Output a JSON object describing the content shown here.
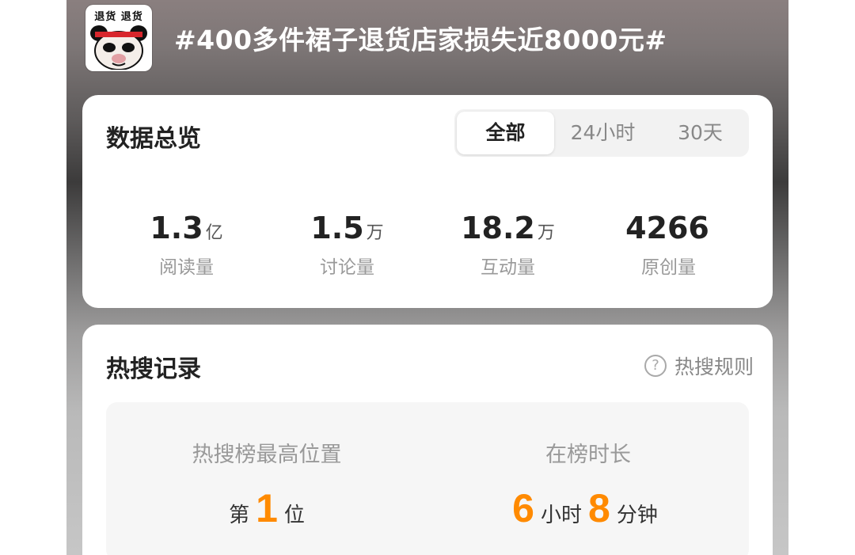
{
  "header": {
    "avatar_text": "退货 退货",
    "topic_title": "#400多件裙子退货店家损失近8000元#"
  },
  "overview": {
    "title": "数据总览",
    "tabs": [
      {
        "label": "全部",
        "active": true
      },
      {
        "label": "24小时",
        "active": false
      },
      {
        "label": "30天",
        "active": false
      }
    ],
    "stats": [
      {
        "value": "1.3",
        "unit": "亿",
        "label": "阅读量"
      },
      {
        "value": "1.5",
        "unit": "万",
        "label": "讨论量"
      },
      {
        "value": "18.2",
        "unit": "万",
        "label": "互动量"
      },
      {
        "value": "4266",
        "unit": "",
        "label": "原创量"
      }
    ]
  },
  "hot_search": {
    "title": "热搜记录",
    "rules_label": "热搜规则",
    "rules_icon": "question-circle-icon",
    "peak": {
      "label": "热搜榜最高位置",
      "prefix": "第",
      "value": "1",
      "suffix": "位"
    },
    "duration": {
      "label": "在榜时长",
      "hours": "6",
      "hours_unit": "小时",
      "minutes": "8",
      "minutes_unit": "分钟"
    }
  },
  "colors": {
    "accent": "#ff8a00",
    "card_bg": "#ffffff"
  }
}
